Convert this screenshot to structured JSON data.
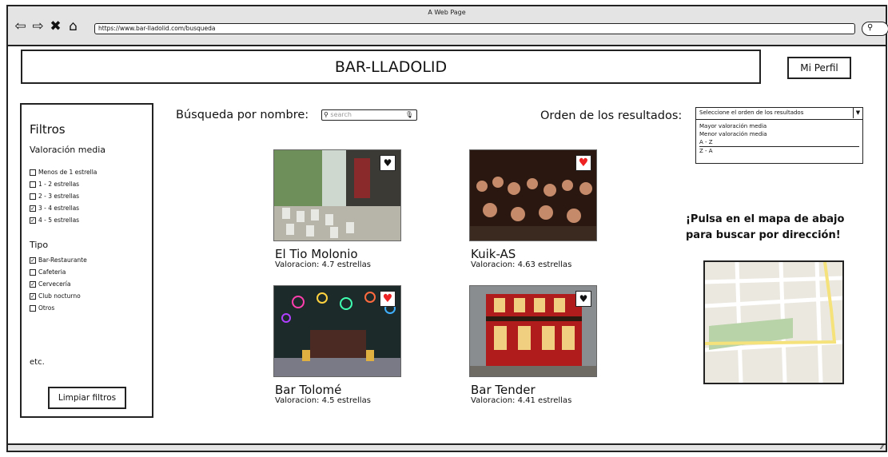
{
  "window": {
    "title": "A Web Page",
    "url": "https://www.bar-lladolid.com/busqueda",
    "nav_icons": [
      "back-icon",
      "forward-icon",
      "close-icon",
      "home-icon"
    ],
    "search_icon": "search-icon"
  },
  "header": {
    "site_title": "BAR-LLADOLID",
    "profile_button": "Mi Perfil"
  },
  "filters": {
    "title": "Filtros",
    "rating_section": "Valoración media",
    "rating_options": [
      {
        "label": "Menos de 1 estrella",
        "checked": false
      },
      {
        "label": "1 - 2 estrellas",
        "checked": false
      },
      {
        "label": "2 - 3 estrellas",
        "checked": false
      },
      {
        "label": "3 - 4 estrellas",
        "checked": true
      },
      {
        "label": "4 - 5 estrellas",
        "checked": true
      }
    ],
    "type_section": "Tipo",
    "type_options": [
      {
        "label": "Bar-Restaurante",
        "checked": true
      },
      {
        "label": "Cafeteria",
        "checked": false
      },
      {
        "label": "Cervecería",
        "checked": true
      },
      {
        "label": "Club nocturno",
        "checked": true
      },
      {
        "label": "Otros",
        "checked": false
      }
    ],
    "etc": "etc.",
    "clear_button": "Limpiar filtros"
  },
  "search": {
    "label": "Búsqueda por nombre:",
    "placeholder": "search"
  },
  "order": {
    "label": "Orden de los resultados:",
    "selected": "Seleccione el orden de los resultados",
    "options": [
      "Mayor valoración media",
      "Menor valoración media",
      "A - Z",
      "Z - A"
    ]
  },
  "results": [
    {
      "name": "El Tio Molonio",
      "rating": "Valoracion: 4.7 estrellas",
      "favorite": false
    },
    {
      "name": "Kuik-AS",
      "rating": "Valoracion: 4.63 estrellas",
      "favorite": true
    },
    {
      "name": "Bar Tolomé",
      "rating": "Valoracion: 4.5 estrellas",
      "favorite": true
    },
    {
      "name": "Bar Tender",
      "rating": "Valoracion: 4.41 estrellas",
      "favorite": false
    }
  ],
  "map": {
    "prompt": "¡Pulsa en el mapa de abajo para buscar por dirección!"
  }
}
